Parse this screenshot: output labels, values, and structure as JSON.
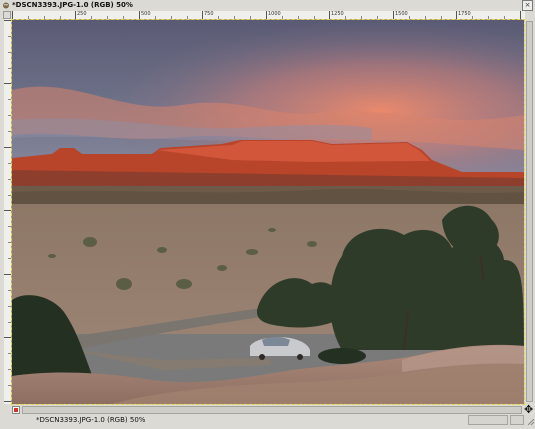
{
  "window": {
    "title": "*DSCN3393.JPG-1.0 (RGB) 50%",
    "close_symbol": "×"
  },
  "rulers": {
    "horizontal_labels": [
      "250",
      "500",
      "750",
      "1000",
      "1250",
      "1500",
      "1750"
    ],
    "vertical_labels": []
  },
  "status": {
    "text": "*DSCN3393.JPG-1.0 (RGB) 50%"
  },
  "icons": {
    "window_icon": "gimp-wilber-icon",
    "close": "close-icon",
    "quick_mask": "quick-mask-toggle-icon",
    "navigate": "navigate-icon",
    "resize": "resize-grip-icon"
  },
  "canvas": {
    "image_name": "DSCN3393.JPG",
    "zoom": "50%"
  }
}
